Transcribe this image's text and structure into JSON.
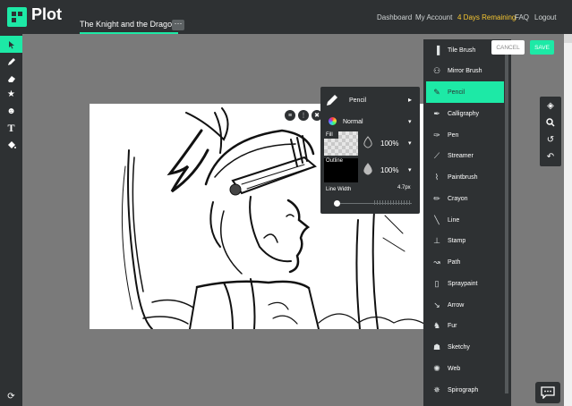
{
  "app": {
    "name": "Plot"
  },
  "document": {
    "title": "The Knight and the Dragon",
    "menu_label": "···"
  },
  "nav": [
    {
      "label": "Dashboard"
    },
    {
      "label": "My Account"
    },
    {
      "label": "4 Days Remaining"
    },
    {
      "label": "FAQ"
    },
    {
      "label": "Logout"
    }
  ],
  "actions": {
    "cancel": "CANCEL",
    "save": "SAVE"
  },
  "brush_settings": {
    "brush_name": "Pencil",
    "blend_mode": "Normal",
    "fill_label": "Fill",
    "fill_opacity": "100%",
    "outline_label": "Outline",
    "outline_opacity": "100%",
    "line_width_label": "Line Width",
    "line_width_value": "4.7px"
  },
  "brushes": [
    {
      "label": "Tile Brush",
      "icon": "tile-brush-icon"
    },
    {
      "label": "Mirror Brush",
      "icon": "mirror-brush-icon"
    },
    {
      "label": "Pencil",
      "icon": "pencil-icon",
      "active": true
    },
    {
      "label": "Calligraphy",
      "icon": "calligraphy-icon"
    },
    {
      "label": "Pen",
      "icon": "pen-icon"
    },
    {
      "label": "Streamer",
      "icon": "streamer-icon"
    },
    {
      "label": "Paintbrush",
      "icon": "paintbrush-icon"
    },
    {
      "label": "Crayon",
      "icon": "crayon-icon"
    },
    {
      "label": "Line",
      "icon": "line-icon"
    },
    {
      "label": "Stamp",
      "icon": "stamp-icon"
    },
    {
      "label": "Path",
      "icon": "path-icon"
    },
    {
      "label": "Spraypaint",
      "icon": "spraypaint-icon"
    },
    {
      "label": "Arrow",
      "icon": "arrow-icon"
    },
    {
      "label": "Fur",
      "icon": "fur-icon"
    },
    {
      "label": "Sketchy",
      "icon": "sketchy-icon"
    },
    {
      "label": "Web",
      "icon": "web-icon"
    },
    {
      "label": "Spirograph",
      "icon": "spirograph-icon"
    }
  ],
  "left_tools": [
    "select-icon",
    "pencil-icon",
    "eraser-icon",
    "star-icon",
    "emoji-icon",
    "text-icon",
    "fill-icon"
  ],
  "right_tools": [
    "layers-icon",
    "search-icon",
    "history-icon",
    "undo-icon"
  ],
  "colors": {
    "accent": "#1de9a6",
    "dark": "#2e3133",
    "highlight": "#f4c531",
    "workspace": "#7a7a7a"
  }
}
